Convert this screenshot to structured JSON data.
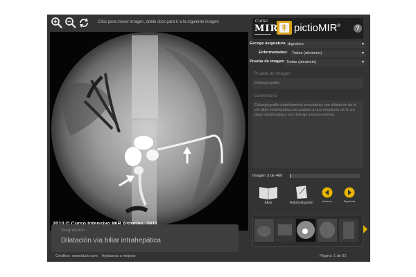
{
  "toolbar": {
    "hint": "Click para mover imagen, doble click para ir a la siguiente imagen",
    "tools": [
      "zoom-in-icon",
      "zoom-out-icon",
      "reset-icon"
    ]
  },
  "viewer": {
    "copyright": "2010 © Curso Intensivo MIR Asturias, 2011"
  },
  "diagnosis": {
    "label": "Diagnóstico",
    "text": "Dilatación vía biliar intrahepática"
  },
  "footer": {
    "credits_label": "Créditos:",
    "credits_link": "www.laulo.com",
    "help_link": "Ayúdanos a mejorar",
    "page_label": "Página:",
    "page_value": "1 de 92"
  },
  "brand": {
    "curso": "Curso",
    "mir": "MIR",
    "product": "pictioMIR",
    "reg": "®",
    "help": "?"
  },
  "filters": [
    {
      "label": "Escoge asignatura :",
      "value": "digestivo"
    },
    {
      "label": "Enfermedades:",
      "value": "Todas (aleatorio)"
    },
    {
      "label": "Prueba de imagen:",
      "value": "Todas (aleatorio)"
    }
  ],
  "test": {
    "label": "Prueba de imagen",
    "value": "Colangiografía"
  },
  "comment": {
    "label": "Comentario",
    "text": "Colangiografía transhumeral percutánea con dilatación de la vía biliar intrahepática secundaria a una neoplasia de la vía biliar extrahepática con drenaje interno-externo."
  },
  "navigation": {
    "image_count": "Imagen 3 de 460",
    "progress_fraction": 0.0065,
    "atlas": "Atlas",
    "autoevaluacion": "Autoevaluación",
    "anterior": "Anterior",
    "siguiente": "Siguiente"
  },
  "colors": {
    "background": "#333333",
    "accent": "#e0b000",
    "logo": "#d9a21a"
  }
}
